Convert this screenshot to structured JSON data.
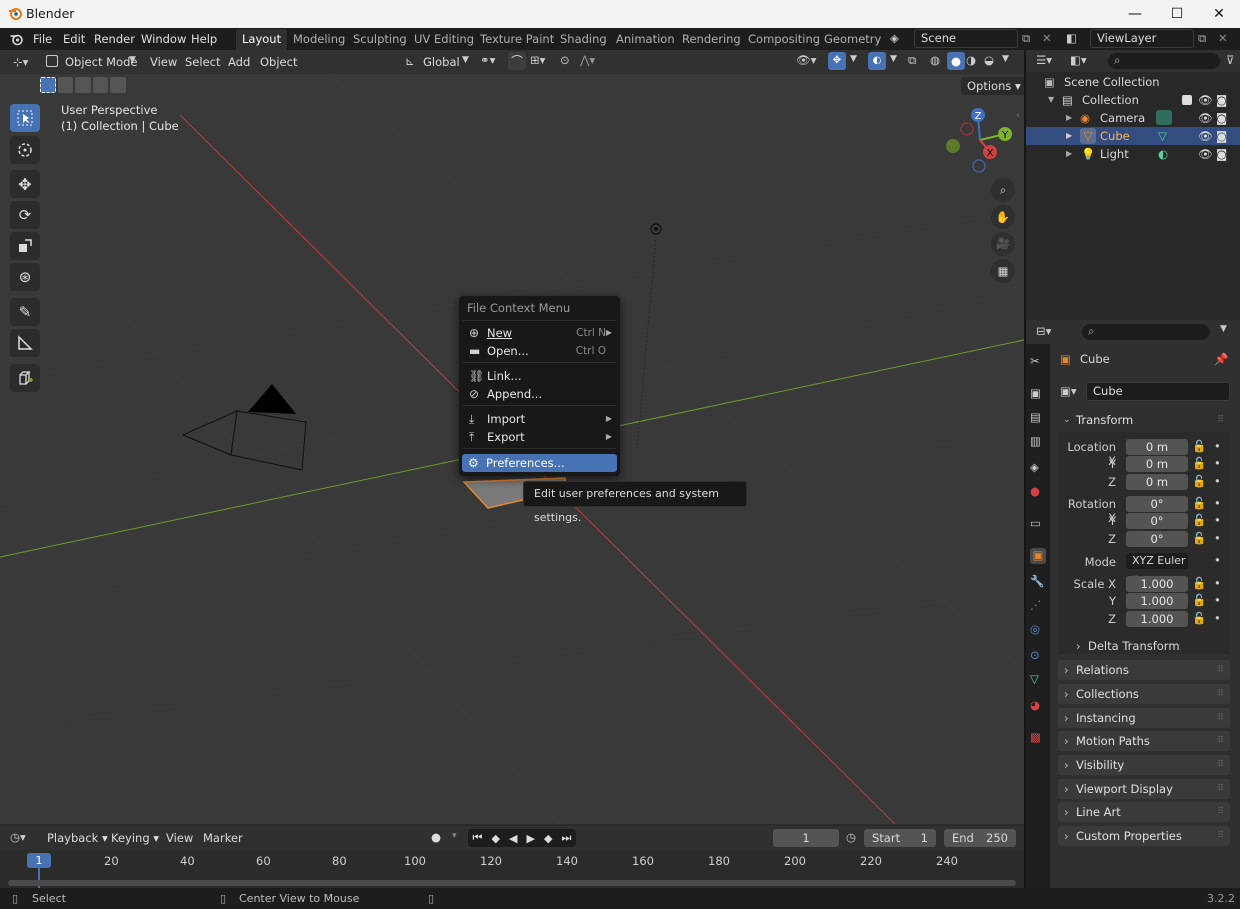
{
  "window": {
    "title": "Blender",
    "minimize": "—",
    "maximize": "☐",
    "close": "✕"
  },
  "topbar": {
    "menus": [
      "File",
      "Edit",
      "Render",
      "Window",
      "Help"
    ],
    "workspaces": [
      "Layout",
      "Modeling",
      "Sculpting",
      "UV Editing",
      "Texture Paint",
      "Shading",
      "Animation",
      "Rendering",
      "Compositing",
      "Geometry N"
    ],
    "active_workspace": "Layout",
    "scene": "Scene",
    "view_layer": "ViewLayer"
  },
  "viewport": {
    "mode": "Object Mode",
    "menus": [
      "View",
      "Select",
      "Add",
      "Object"
    ],
    "orientation": "Global",
    "options": "Options",
    "overlay_line1": "User Perspective",
    "overlay_line2": "(1) Collection | Cube",
    "gizmo": {
      "z": "Z",
      "y": "Y",
      "x": "X"
    }
  },
  "context_menu": {
    "title": "File Context Menu",
    "items": [
      {
        "label": "New",
        "shortcut": "Ctrl N"
      },
      {
        "label": "Open...",
        "shortcut": "Ctrl O"
      },
      {
        "label": "Link...",
        "shortcut": ""
      },
      {
        "label": "Append...",
        "shortcut": ""
      },
      {
        "label": "Import",
        "shortcut": ""
      },
      {
        "label": "Export",
        "shortcut": ""
      },
      {
        "label": "Preferences...",
        "shortcut": ""
      }
    ],
    "highlighted": "Preferences...",
    "tooltip": "Edit user preferences and system settings."
  },
  "outliner": {
    "items": [
      {
        "label": "Scene Collection"
      },
      {
        "label": "Collection"
      },
      {
        "label": "Camera"
      },
      {
        "label": "Cube"
      },
      {
        "label": "Light"
      }
    ],
    "selected": "Cube"
  },
  "properties": {
    "object_name": "Cube",
    "object_field": "Cube",
    "transform_title": "Transform",
    "location": {
      "label": "Location X",
      "x": "0 m",
      "y": "0 m",
      "z": "0 m"
    },
    "rotation": {
      "label": "Rotation X",
      "x": "0°",
      "y": "0°",
      "z": "0°"
    },
    "mode_label": "Mode",
    "mode_value": "XYZ Euler",
    "scale": {
      "label": "Scale X",
      "x": "1.000",
      "y": "1.000",
      "z": "1.000"
    },
    "axis_y": "Y",
    "axis_z": "Z",
    "delta": "Delta Transform",
    "panels": [
      "Relations",
      "Collections",
      "Instancing",
      "Motion Paths",
      "Visibility",
      "Viewport Display",
      "Line Art",
      "Custom Properties"
    ]
  },
  "timeline": {
    "menus": [
      "Playback",
      "Keying",
      "View",
      "Marker"
    ],
    "current_frame": "1",
    "start_label": "Start",
    "start": "1",
    "end_label": "End",
    "end": "250",
    "ticks": [
      "20",
      "40",
      "60",
      "80",
      "100",
      "120",
      "140",
      "160",
      "180",
      "200",
      "220",
      "240"
    ],
    "playhead": "1"
  },
  "statusbar": {
    "select": "Select",
    "center": "Center View to Mouse",
    "version": "3.2.2"
  },
  "colors": {
    "accent": "#4772b3",
    "x_axis": "#d24242",
    "y_axis": "#7db22c",
    "selected_orange": "#e8872e"
  }
}
